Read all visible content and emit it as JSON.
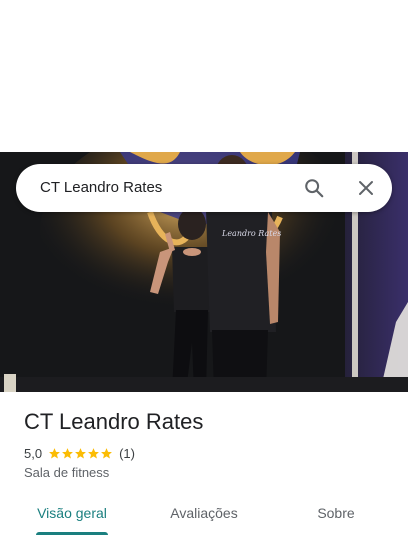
{
  "search": {
    "query": "CT Leandro Rates",
    "search_icon": "search-icon",
    "close_icon": "close-icon"
  },
  "hero": {
    "image": "gym-photo-two-people",
    "shirt_text": "Leandro Rates"
  },
  "place": {
    "name": "CT Leandro Rates",
    "rating": "5,0",
    "stars": 5,
    "review_count": "(1)",
    "category": "Sala de fitness"
  },
  "tabs": [
    {
      "label": "Visão geral",
      "active": true
    },
    {
      "label": "Avaliações",
      "active": false
    },
    {
      "label": "Sobre",
      "active": false
    }
  ],
  "colors": {
    "accent": "#1a7f7f",
    "star": "#fbbc04"
  }
}
